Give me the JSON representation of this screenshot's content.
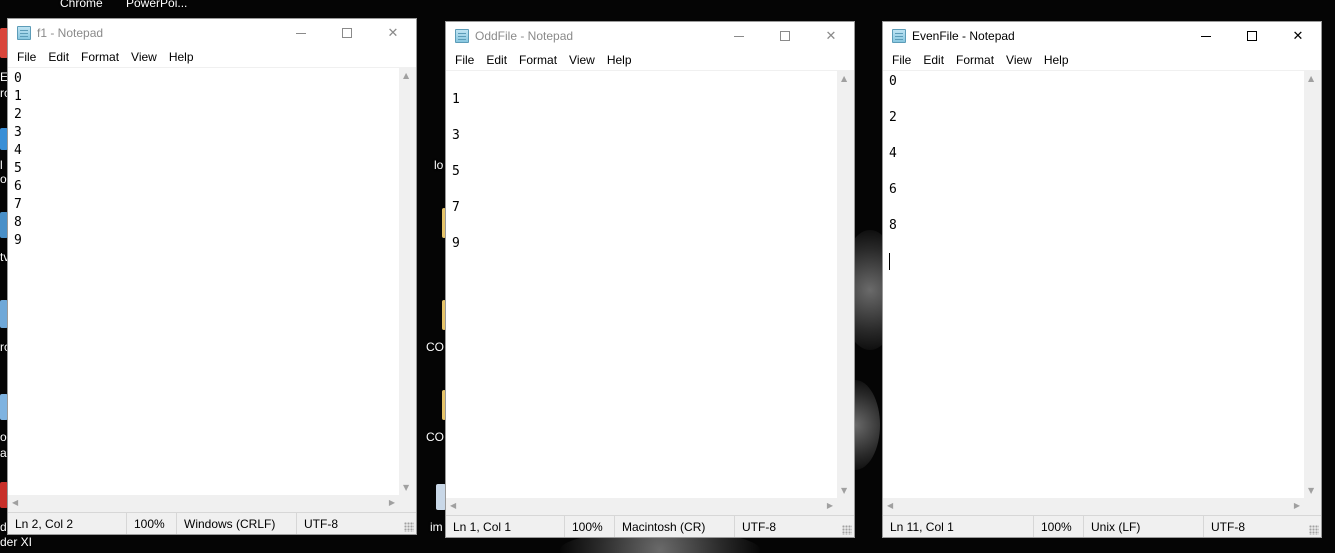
{
  "desktop": {
    "top_labels": [
      "Chrome",
      "PowerPoi..."
    ],
    "left_labels": [
      "E",
      "ro",
      "l",
      "o",
      "tv",
      "rc",
      "on",
      "ar",
      "dc",
      "der XI"
    ],
    "middle_labels": [
      "lo",
      "CO",
      "CO",
      "im"
    ]
  },
  "windows": [
    {
      "title": "f1 - Notepad",
      "active": false,
      "menu": [
        "File",
        "Edit",
        "Format",
        "View",
        "Help"
      ],
      "lines": [
        "0",
        "1",
        "2",
        "3",
        "4",
        "5",
        "6",
        "7",
        "8",
        "9"
      ],
      "status": {
        "position": "Ln 2, Col 2",
        "zoom": "100%",
        "line_ending": "Windows (CRLF)",
        "encoding": "UTF-8"
      }
    },
    {
      "title": "OddFile - Notepad",
      "active": false,
      "menu": [
        "File",
        "Edit",
        "Format",
        "View",
        "Help"
      ],
      "lines": [
        "",
        "1",
        "",
        "3",
        "",
        "5",
        "",
        "7",
        "",
        "9"
      ],
      "status": {
        "position": "Ln 1, Col 1",
        "zoom": "100%",
        "line_ending": "Macintosh (CR)",
        "encoding": "UTF-8"
      }
    },
    {
      "title": "EvenFile - Notepad",
      "active": true,
      "menu": [
        "File",
        "Edit",
        "Format",
        "View",
        "Help"
      ],
      "lines": [
        "0",
        "",
        "2",
        "",
        "4",
        "",
        "6",
        "",
        "8",
        "",
        ""
      ],
      "status": {
        "position": "Ln 11, Col 1",
        "zoom": "100%",
        "line_ending": "Unix (LF)",
        "encoding": "UTF-8"
      }
    }
  ],
  "controls": {
    "minimize": "minimize-icon",
    "maximize": "maximize-icon",
    "close": "close-icon"
  }
}
